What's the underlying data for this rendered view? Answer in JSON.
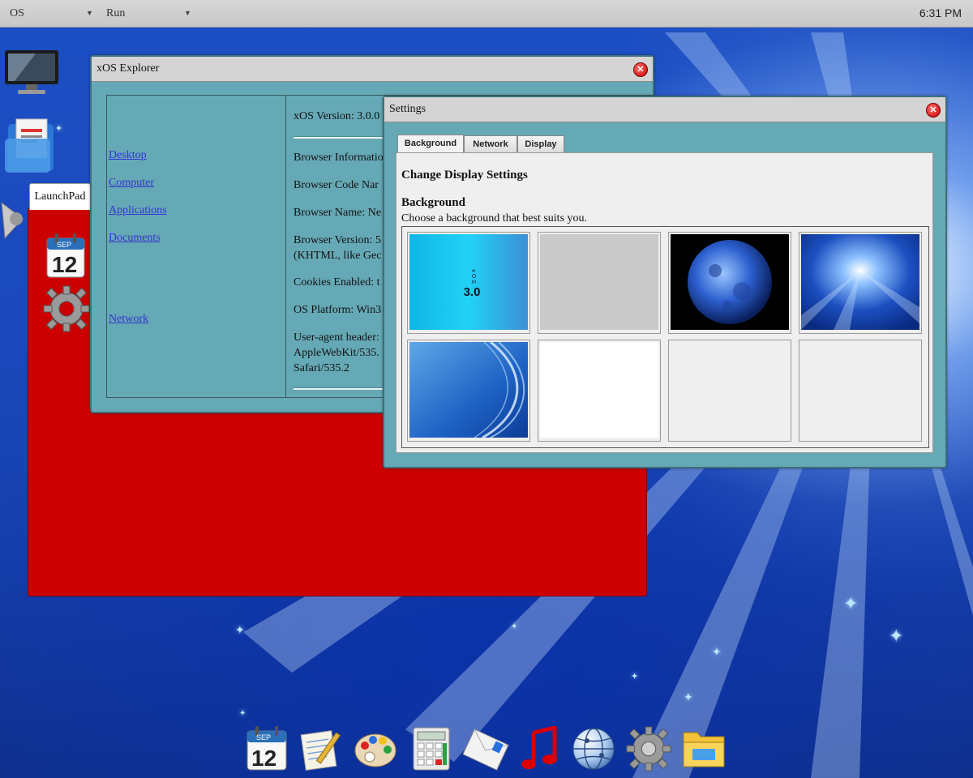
{
  "topbar": {
    "menu_os": "OS",
    "menu_run": "Run",
    "dropdown_arrow": "▼",
    "clock": "6:31 PM"
  },
  "launchpad": {
    "tab_label": "LaunchPad",
    "calendar_month": "SEP",
    "calendar_day": "12"
  },
  "explorer": {
    "title": "xOS Explorer",
    "nav": [
      "Desktop",
      "Computer",
      "Applications",
      "Documents",
      "Network"
    ],
    "info": {
      "version": "xOS Version: 3.0.0",
      "browser_info": "Browser Informatio",
      "code_name": "Browser Code Nar",
      "browser_name": "Browser Name: Ne",
      "browser_version_1": "Browser Version: 5",
      "browser_version_2": "(KHTML, like Gec",
      "cookies": "Cookies Enabled: t",
      "platform": "OS Platform: Win3",
      "ua_1": "User-agent header:",
      "ua_2": "AppleWebKit/535.",
      "ua_3": "Safari/535.2"
    }
  },
  "settings": {
    "title": "Settings",
    "tabs": [
      "Background",
      "Network",
      "Display"
    ],
    "heading": "Change Display Settings",
    "section_title": "Background",
    "section_desc": "Choose a background that best suits you.",
    "thumb_os_text": "x O S",
    "thumb_version_text": "3.0"
  },
  "dock": {
    "calendar_month": "SEP",
    "calendar_day": "12",
    "icons": [
      "calendar-icon",
      "notepad-icon",
      "paint-palette-icon",
      "calculator-icon",
      "mail-icon",
      "music-icon",
      "browser-globe-icon",
      "settings-gear-icon",
      "folder-icon"
    ]
  },
  "colors": {
    "window_body": "#66a9b6",
    "titlebar": "#d4d4d4",
    "launchpad": "#cc0000",
    "desktop": "#1b49bd"
  }
}
